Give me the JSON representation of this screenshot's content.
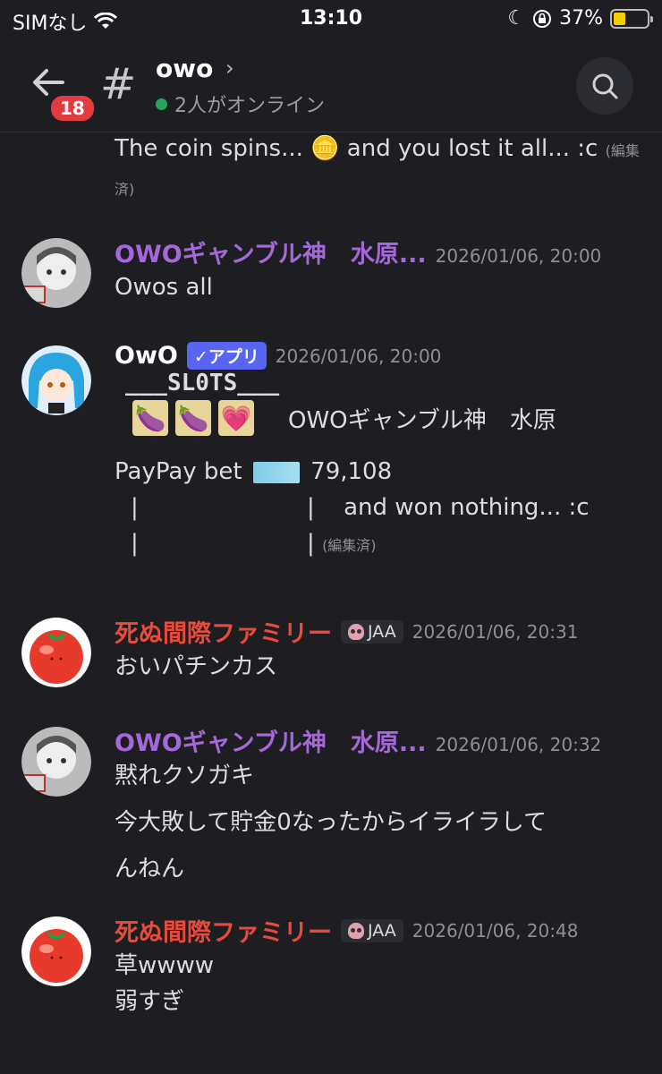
{
  "statusbar": {
    "carrier": "SIMなし",
    "time": "13:10",
    "battery": "37%"
  },
  "header": {
    "back_badge": "18",
    "channel_name": "owo",
    "online_text": "2人がオンライン"
  },
  "messages": [
    {
      "text": "The coin spins... 🪙 and you lost it all... :c",
      "edited": "(編集済)"
    },
    {
      "user": "OWOギャンブル神　水原...",
      "timestamp": "2026/01/06, 20:00",
      "text": "Owos all"
    },
    {
      "user": "OwO",
      "tag": "✓アプリ",
      "timestamp": "2026/01/06, 20:00",
      "slots_title": "___SL0TS___",
      "slots": [
        "🍆",
        "🍆",
        "💗"
      ],
      "slots_player": "OWOギャンブル神　水原",
      "bet_prefix": "PayPay bet",
      "bet_amount": "79,108",
      "line1_pipe_a": "|",
      "line1_pipe_b": "|",
      "line1_text": "and won nothing... :c",
      "line2_pipe_a": "|",
      "line2_pipe_b": "|",
      "edited": "(編集済)"
    },
    {
      "user": "死ぬ間際ファミリー",
      "role": "JAA",
      "timestamp": "2026/01/06, 20:31",
      "text": "おいパチンカス"
    },
    {
      "user": "OWOギャンブル神　水原...",
      "timestamp": "2026/01/06, 20:32",
      "text1": "黙れクソガキ",
      "text2": "今大敗して貯金0なったからイライラして",
      "text3": "んねん"
    },
    {
      "user": "死ぬ間際ファミリー",
      "role": "JAA",
      "timestamp": "2026/01/06, 20:48",
      "text1": "草wwww",
      "text2": "弱すぎ"
    }
  ]
}
